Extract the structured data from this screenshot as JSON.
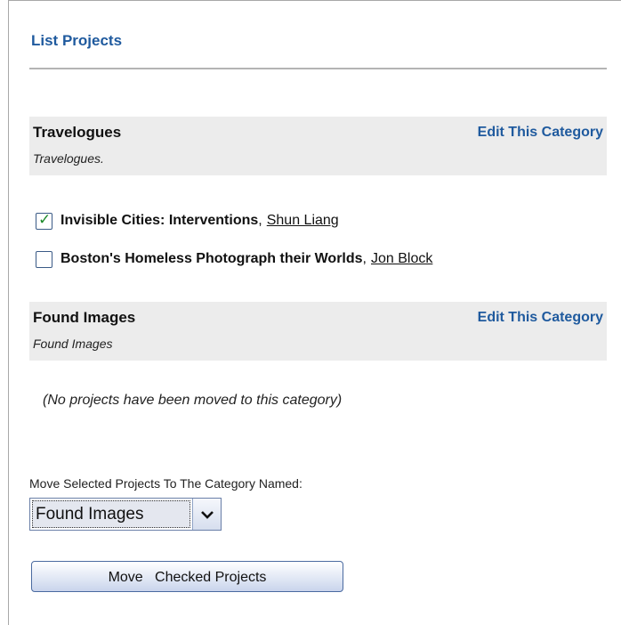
{
  "page": {
    "title": "List Projects"
  },
  "categories": [
    {
      "name": "Travelogues",
      "edit_label": "Edit This Category",
      "description": "Travelogues.",
      "projects": [
        {
          "title": "Invisible Cities: Interventions",
          "separator": ",",
          "author": "Shun Liang",
          "checked": true
        },
        {
          "title": "Boston's Homeless Photograph their Worlds",
          "separator": ",",
          "author": "Jon Block",
          "checked": false
        }
      ]
    },
    {
      "name": "Found Images",
      "edit_label": "Edit This Category",
      "description": "Found Images",
      "empty_message": "(No projects have been moved to this category)"
    }
  ],
  "move": {
    "label": "Move Selected Projects To The Category Named:",
    "selected_value": "Found Images",
    "button_label": "Move   Checked Projects"
  },
  "icons": {
    "checkbox_checked": "checkmark-icon",
    "select_arrow": "chevron-down-icon"
  },
  "colors": {
    "accent": "#1f5a9e",
    "category_bg": "#ececec"
  }
}
